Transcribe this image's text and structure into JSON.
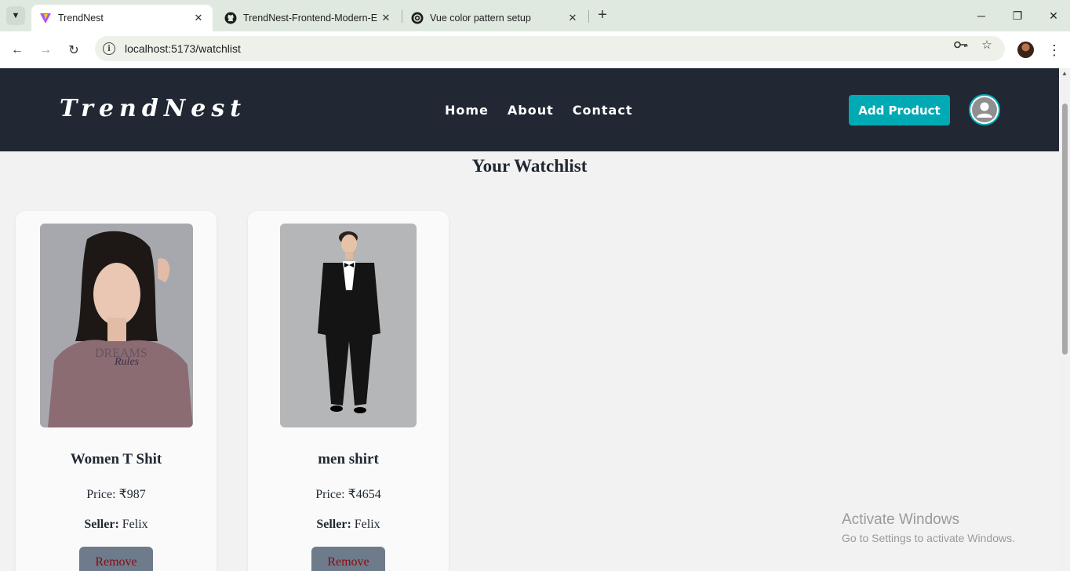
{
  "browser": {
    "tabs": [
      {
        "title": "TrendNest",
        "active": true,
        "icon": "vite-icon"
      },
      {
        "title": "TrendNest-Frontend-Modern-E",
        "active": false,
        "icon": "github-icon"
      },
      {
        "title": "Vue color pattern setup",
        "active": false,
        "icon": "chatgpt-icon"
      }
    ],
    "url": "localhost:5173/watchlist"
  },
  "site": {
    "brand": "TrendNest",
    "nav": [
      "Home",
      "About",
      "Contact"
    ],
    "add_product_label": "Add Product",
    "accent_color": "#00aab4",
    "nav_bg_color": "#212833"
  },
  "main": {
    "title": "Your Watchlist",
    "items": [
      {
        "name": "Women T Shit",
        "price": "Price: ₹987",
        "seller_label": "Seller:",
        "seller": "Felix",
        "remove_label": "Remove"
      },
      {
        "name": "men shirt",
        "price": "Price: ₹4654",
        "seller_label": "Seller:",
        "seller": "Felix",
        "remove_label": "Remove"
      }
    ]
  },
  "watermark": {
    "line1": "Activate Windows",
    "line2": "Go to Settings to activate Windows."
  }
}
